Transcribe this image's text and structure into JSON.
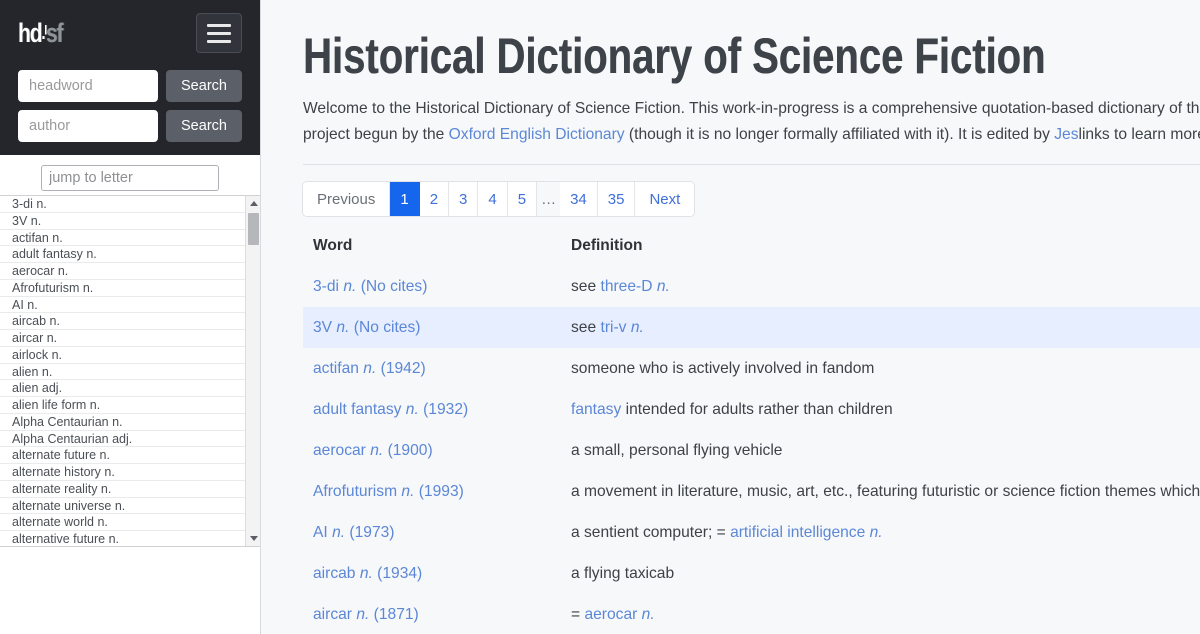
{
  "sidebar": {
    "logo_main": "hd",
    "logo_tick": ".ᴵ",
    "logo_sf": "sf",
    "menu_icon": "hamburger-icon",
    "headword_placeholder": "headword",
    "headword_value": "",
    "author_placeholder": "author",
    "author_value": "",
    "search_label_1": "Search",
    "search_label_2": "Search",
    "jump_placeholder": "jump to letter",
    "jump_value": "",
    "words": [
      "3-di n.",
      "3V n.",
      "actifan n.",
      "adult fantasy n.",
      "aerocar n.",
      "Afrofuturism n.",
      "AI n.",
      "aircab n.",
      "aircar n.",
      "airlock n.",
      "alien n.",
      "alien adj.",
      "alien life form n.",
      "Alpha Centaurian n.",
      "Alpha Centaurian adj.",
      "alternate future n.",
      "alternate history n.",
      "alternate reality n.",
      "alternate universe n.",
      "alternate world n.",
      "alternative future n."
    ]
  },
  "main": {
    "title": "Historical Dictionary of Science Fiction",
    "intro": {
      "part1": "Welcome to the Historical Dictionary of Science Fiction. This work-in-progress is a comprehensive quotation-based dictionary of the",
      "part2": "is an offshoot of a project begun by the ",
      "oed_link": "Oxford English Dictionary",
      "part3": " (though it is no longer formally affiliated with it). It is edited by ",
      "editor_link": "Jes",
      "part4": "links to learn more."
    },
    "pagination": {
      "previous": "Previous",
      "pages": [
        "1",
        "2",
        "3",
        "4",
        "5"
      ],
      "gap": "…",
      "tail_pages": [
        "34",
        "35"
      ],
      "next": "Next",
      "active": "1"
    },
    "table": {
      "headers": [
        "Word",
        "Definition"
      ],
      "rows": [
        {
          "word": "3-di",
          "pos": "n.",
          "suffix": "(No cites)",
          "def_prefix": "see ",
          "def_link": "three-D",
          "def_link_pos": "n.",
          "def_suffix": "",
          "hover": false
        },
        {
          "word": "3V",
          "pos": "n.",
          "suffix": "(No cites)",
          "def_prefix": "see ",
          "def_link": "tri-v",
          "def_link_pos": "n.",
          "def_suffix": "",
          "hover": true
        },
        {
          "word": "actifan",
          "pos": "n.",
          "suffix": "(1942)",
          "def_prefix": "someone who is actively involved in fandom",
          "def_link": "",
          "def_link_pos": "",
          "def_suffix": "",
          "hover": false
        },
        {
          "word": "adult fantasy",
          "pos": "n.",
          "suffix": "(1932)",
          "def_prefix": "",
          "def_link": "fantasy",
          "def_link_pos": "",
          "def_suffix": " intended for adults rather than children",
          "hover": false
        },
        {
          "word": "aerocar",
          "pos": "n.",
          "suffix": "(1900)",
          "def_prefix": "a small, personal flying vehicle",
          "def_link": "",
          "def_link_pos": "",
          "def_suffix": "",
          "hover": false
        },
        {
          "word": "Afrofuturism",
          "pos": "n.",
          "suffix": "(1993)",
          "def_prefix": "a movement in literature, music, art, etc., featuring futuristic or science fiction themes which and culture",
          "def_link": "",
          "def_link_pos": "",
          "def_suffix": "",
          "hover": false
        },
        {
          "word": "AI",
          "pos": "n.",
          "suffix": "(1973)",
          "def_prefix": "a sentient computer; = ",
          "def_link": "artificial intelligence",
          "def_link_pos": "n.",
          "def_suffix": "",
          "hover": false
        },
        {
          "word": "aircab",
          "pos": "n.",
          "suffix": "(1934)",
          "def_prefix": "a flying taxicab",
          "def_link": "",
          "def_link_pos": "",
          "def_suffix": "",
          "hover": false
        },
        {
          "word": "aircar",
          "pos": "n.",
          "suffix": "(1871)",
          "def_prefix": "= ",
          "def_link": "aerocar",
          "def_link_pos": "n.",
          "def_suffix": "",
          "hover": false
        }
      ]
    }
  },
  "colors": {
    "sidebar_dark": "#24262b",
    "accent_blue": "#1565ed",
    "link_blue": "#5b87d6",
    "hover_row": "#e6eeff",
    "page_bg": "#f7f8fa"
  }
}
